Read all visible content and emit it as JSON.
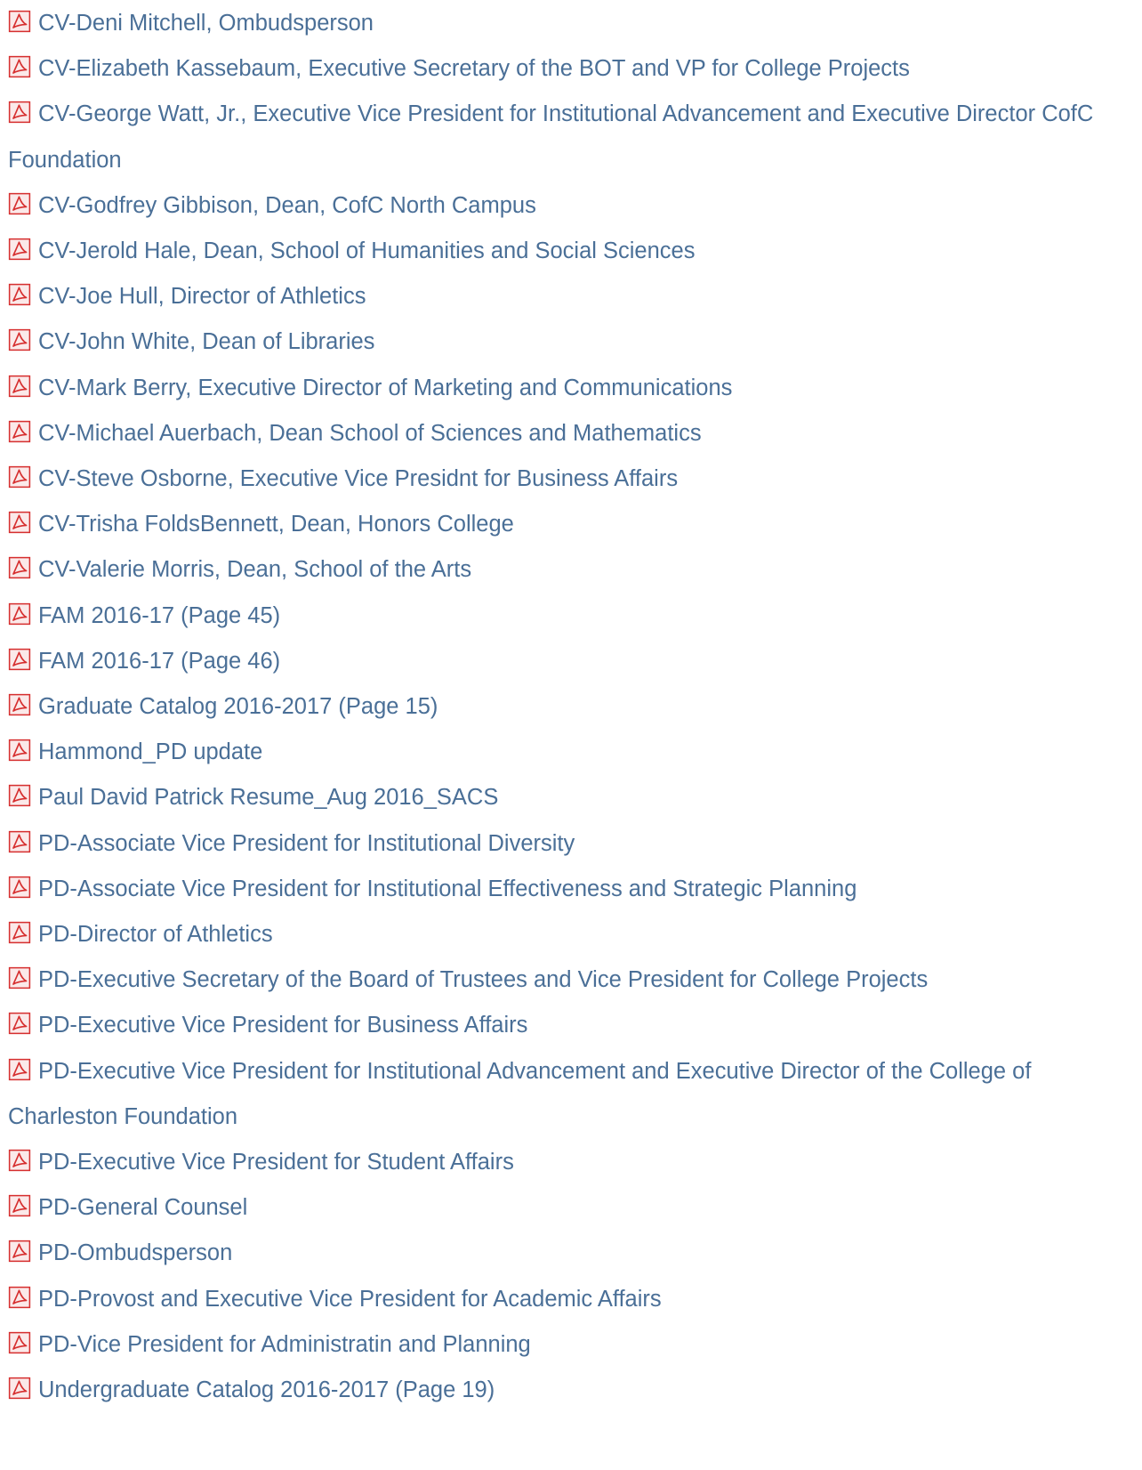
{
  "colors": {
    "link": "#4a6f97",
    "pdf_icon": "#d62f2f"
  },
  "icon": "pdf-file-icon",
  "documents": [
    "CV-Deni Mitchell, Ombudsperson",
    "CV-Elizabeth Kassebaum, Executive Secretary of the BOT and VP for College Projects",
    "CV-George Watt, Jr., Executive Vice President for Institutional Advancement and Executive Director CofC Foundation",
    "CV-Godfrey Gibbison, Dean, CofC North Campus",
    "CV-Jerold Hale, Dean, School of Humanities and Social Sciences",
    "CV-Joe Hull, Director of Athletics",
    "CV-John White, Dean of Libraries",
    "CV-Mark Berry, Executive Director of Marketing and Communications",
    "CV-Michael Auerbach, Dean School of Sciences and Mathematics",
    "CV-Steve Osborne, Executive Vice Presidnt for Business Affairs",
    "CV-Trisha FoldsBennett, Dean, Honors College",
    "CV-Valerie Morris, Dean, School of the Arts",
    "FAM 2016-17 (Page 45)",
    "FAM 2016-17 (Page 46)",
    "Graduate Catalog 2016-2017 (Page 15)",
    "Hammond_PD update",
    "Paul David Patrick Resume_Aug 2016_SACS",
    "PD-Associate Vice President for Institutional Diversity",
    "PD-Associate Vice President for Institutional Effectiveness and Strategic Planning",
    "PD-Director of Athletics",
    "PD-Executive Secretary of the Board of Trustees and Vice President for College Projects",
    "PD-Executive Vice President for Business Affairs",
    "PD-Executive Vice President for Institutional Advancement and Executive Director of the College of Charleston Foundation",
    "PD-Executive Vice President for Student Affairs",
    "PD-General Counsel",
    "PD-Ombudsperson",
    "PD-Provost and Executive Vice President for Academic Affairs",
    "PD-Vice President for Administratin and Planning",
    "Undergraduate Catalog 2016-2017 (Page 19)"
  ]
}
